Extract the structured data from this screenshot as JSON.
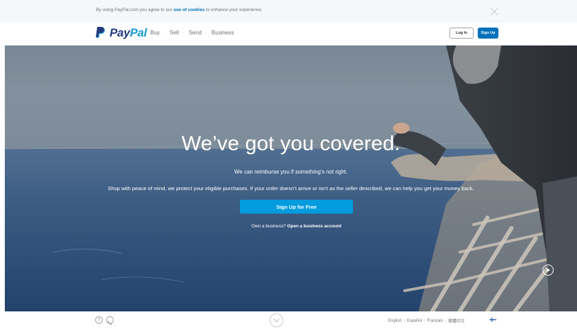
{
  "cookie": {
    "prefix": "By using PayPal.com you agree to our ",
    "link": "use of cookies",
    "suffix": " to enhance your experience."
  },
  "nav": {
    "logo_pay": "Pay",
    "logo_pal": "Pal",
    "links": [
      "Buy",
      "Sell",
      "Send",
      "Business"
    ],
    "separator": "·",
    "login_label": "Log In",
    "signup_label": "Sign Up"
  },
  "hero": {
    "title": "We’ve got you covered.",
    "subtitle": "We can reimburse you if something’s not right.",
    "description": "Shop with peace of mind, we protect your eligible purchases. If your order doesn’t arrive or isn’t as the seller described, we can help you get your money back.",
    "cta_label": "Sign Up for Free",
    "business_prompt": "Own a business? ",
    "business_link": "Open a business account"
  },
  "footer": {
    "help_symbol": "?",
    "languages": [
      "English",
      "Español",
      "Français",
      "繁體中文"
    ],
    "separator": "|"
  },
  "icons": {
    "cookie_close": "close-icon",
    "logo_mark": "paypal-logo-icon",
    "play": "play-icon",
    "help": "help-icon",
    "phone": "phone-icon",
    "scroll": "chevron-down-icon",
    "flag": "finland-flag-icon"
  },
  "colors": {
    "brand_dark": "#253b80",
    "brand_light": "#179bd7",
    "primary_button": "#0070ba",
    "cta_button": "#009cde"
  }
}
